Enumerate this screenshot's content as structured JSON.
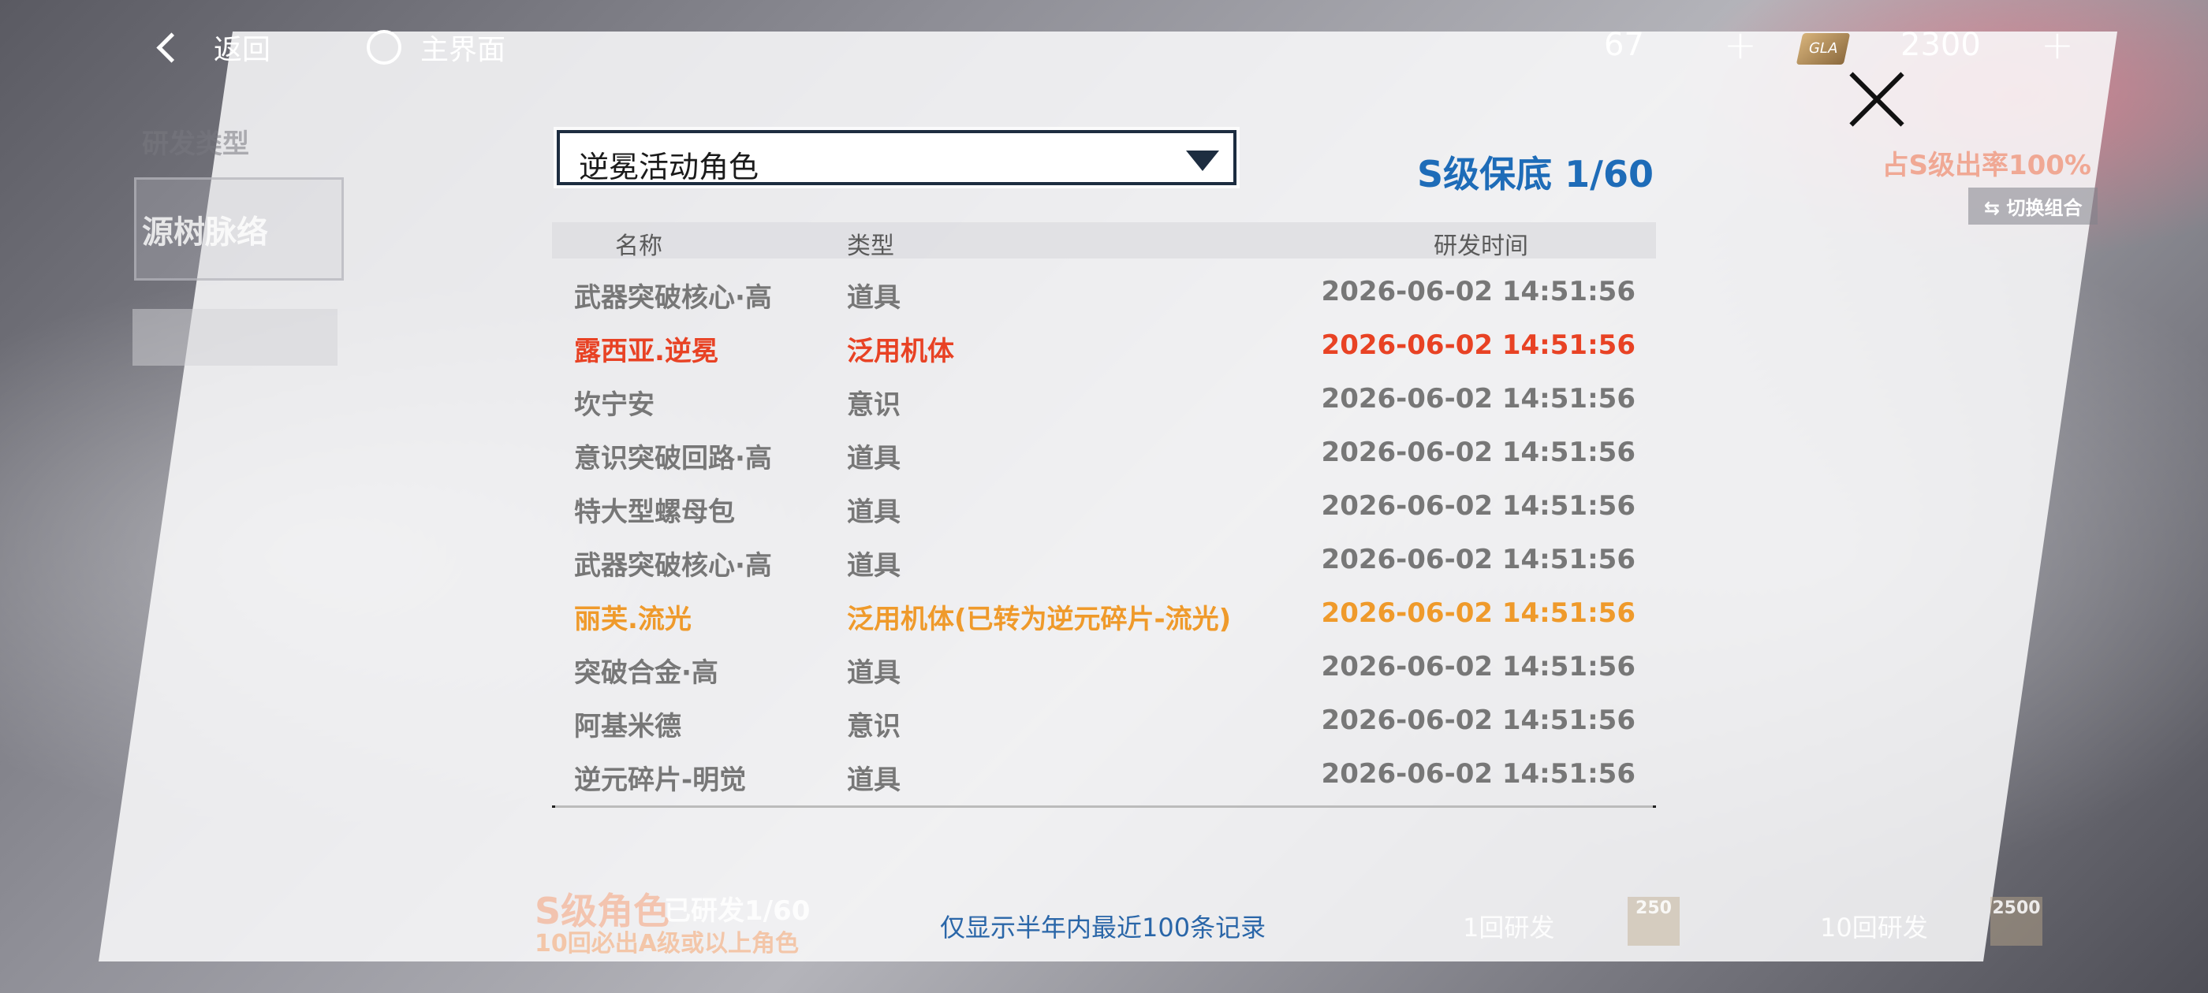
{
  "topbar": {
    "back_label": "返回",
    "home_label": "主界面",
    "resource1_value": "67",
    "resource2_value": "2300",
    "resource2_icon_text": "GLA",
    "plus": "+"
  },
  "background": {
    "rd_type_label": "研发类型",
    "card_title": "源树脉络",
    "s_rate": "占S级出率100%",
    "switch_label": "切换组合",
    "s_guarantee_label": "S级角色",
    "researched_label": "已研发1/60",
    "ten_pull_label": "10回必出A级或以上角色",
    "btn_1_label": "1回研发",
    "btn_1_cost": "250",
    "btn_10_label": "10回研发",
    "btn_10_cost": "2500"
  },
  "dialog": {
    "dropdown_value": "逆冕活动角色",
    "s_guarantee": "S级保底 1/60",
    "headers": {
      "name": "名称",
      "type": "类型",
      "time": "研发时间"
    },
    "rows": [
      {
        "name": "武器突破核心·高",
        "type": "道具",
        "time": "2026-06-02 14:51:56",
        "rarity": "normal"
      },
      {
        "name": "露西亚.逆冕",
        "type": "泛用机体",
        "time": "2026-06-02 14:51:56",
        "rarity": "s"
      },
      {
        "name": "坎宁安",
        "type": "意识",
        "time": "2026-06-02 14:51:56",
        "rarity": "normal"
      },
      {
        "name": "意识突破回路·高",
        "type": "道具",
        "time": "2026-06-02 14:51:56",
        "rarity": "normal"
      },
      {
        "name": "特大型螺母包",
        "type": "道具",
        "time": "2026-06-02 14:51:56",
        "rarity": "normal"
      },
      {
        "name": "武器突破核心·高",
        "type": "道具",
        "time": "2026-06-02 14:51:56",
        "rarity": "normal"
      },
      {
        "name": "丽芙.流光",
        "type": "泛用机体(已转为逆元碎片-流光)",
        "time": "2026-06-02 14:51:56",
        "rarity": "a"
      },
      {
        "name": "突破合金·高",
        "type": "道具",
        "time": "2026-06-02 14:51:56",
        "rarity": "normal"
      },
      {
        "name": "阿基米德",
        "type": "意识",
        "time": "2026-06-02 14:51:56",
        "rarity": "normal"
      },
      {
        "name": "逆元碎片-明觉",
        "type": "道具",
        "time": "2026-06-02 14:51:56",
        "rarity": "normal"
      }
    ],
    "note": "仅显示半年内最近100条记录"
  },
  "colors": {
    "s_rank": "#e84224",
    "a_rank": "#ef9a2b",
    "normal": "#777777",
    "guarantee_blue": "#1e6cb8",
    "note_blue": "#2a66a8"
  }
}
